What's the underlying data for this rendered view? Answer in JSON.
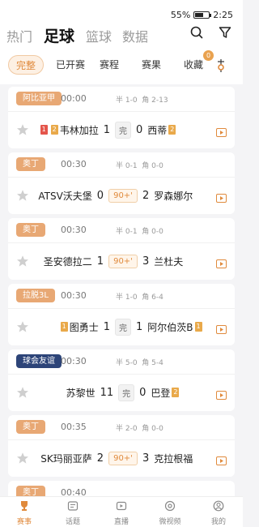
{
  "status": {
    "battery": "55%",
    "time": "2:25"
  },
  "nav": {
    "tabs": [
      "热门",
      "足球",
      "篮球",
      "数据"
    ],
    "active": 1
  },
  "filters": {
    "items": [
      "完整",
      "已开赛",
      "赛程",
      "赛果",
      "收藏"
    ],
    "active": 0,
    "fav_badge": "0"
  },
  "matches": [
    {
      "league": "阿比亚甲",
      "league_color": "orange",
      "time": "00:00",
      "half": "半 1-0",
      "corner": "角 2-13",
      "home_red": "1",
      "home_yel": "2",
      "home": "韦林加拉",
      "home_score": "1",
      "status": "完",
      "away_score": "0",
      "away": "西蒂",
      "away_yel": "2",
      "away_red": ""
    },
    {
      "league": "奥丁",
      "league_color": "orange",
      "time": "00:30",
      "half": "半 0-1",
      "corner": "角 0-0",
      "home_red": "",
      "home_yel": "",
      "home": "ATSV沃夫堡",
      "home_score": "0",
      "status": "90+'",
      "away_score": "2",
      "away": "罗森娜尔",
      "away_yel": "",
      "away_red": ""
    },
    {
      "league": "奥丁",
      "league_color": "orange",
      "time": "00:30",
      "half": "半 0-1",
      "corner": "角 0-0",
      "home_red": "",
      "home_yel": "",
      "home": "圣安德拉二",
      "home_score": "1",
      "status": "90+'",
      "away_score": "3",
      "away": "兰杜夫",
      "away_yel": "",
      "away_red": ""
    },
    {
      "league": "拉脱3L",
      "league_color": "orange",
      "time": "00:30",
      "half": "半 1-0",
      "corner": "角 6-4",
      "home_red": "",
      "home_yel": "1",
      "home": "图勇士",
      "home_score": "1",
      "status": "完",
      "away_score": "1",
      "away": "阿尔伯茨B",
      "away_yel": "1",
      "away_red": ""
    },
    {
      "league": "球会友谊",
      "league_color": "blue",
      "time": "00:30",
      "half": "半 5-0",
      "corner": "角 5-4",
      "home_red": "",
      "home_yel": "",
      "home": "苏黎世",
      "home_score": "11",
      "status": "完",
      "away_score": "0",
      "away": "巴登",
      "away_yel": "2",
      "away_red": ""
    },
    {
      "league": "奥丁",
      "league_color": "orange",
      "time": "00:35",
      "half": "半 2-0",
      "corner": "角 0-0",
      "home_red": "",
      "home_yel": "",
      "home": "SK玛丽亚萨",
      "home_score": "2",
      "status": "90+'",
      "away_score": "3",
      "away": "克拉根福",
      "away_yel": "",
      "away_red": ""
    },
    {
      "league": "奥丁",
      "league_color": "orange",
      "time": "00:40",
      "half": "",
      "corner": "",
      "home_red": "",
      "home_yel": "",
      "home": "",
      "home_score": "",
      "status": "",
      "away_score": "",
      "away": "",
      "away_yel": "",
      "away_red": ""
    }
  ],
  "bottom_nav": {
    "items": [
      "赛事",
      "话题",
      "直播",
      "微视频",
      "我的"
    ],
    "active": 0
  }
}
